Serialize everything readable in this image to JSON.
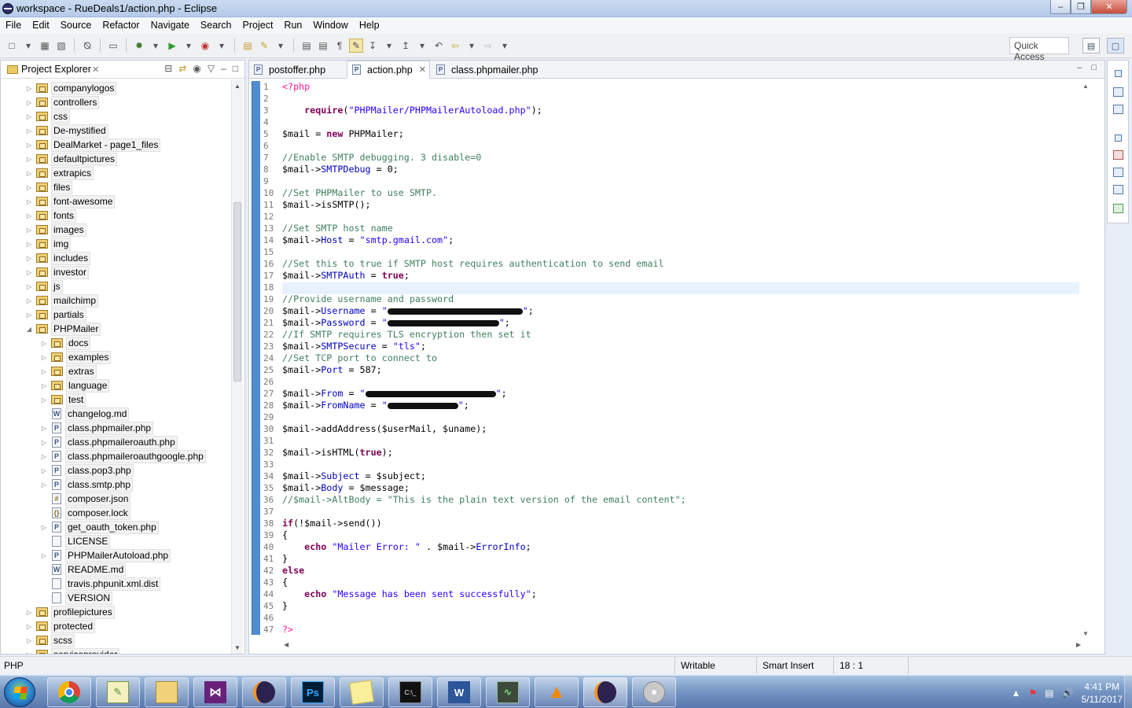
{
  "window": {
    "title": "workspace - RueDeals1/action.php - Eclipse"
  },
  "menu": [
    "File",
    "Edit",
    "Source",
    "Refactor",
    "Navigate",
    "Search",
    "Project",
    "Run",
    "Window",
    "Help"
  ],
  "toolbar": {
    "quick_access": "Quick Access"
  },
  "explorer": {
    "title": "Project Explorer",
    "items": [
      {
        "label": "companylogos",
        "depth": 0,
        "type": "folder",
        "twist": "closed"
      },
      {
        "label": "controllers",
        "depth": 0,
        "type": "folder",
        "twist": "closed"
      },
      {
        "label": "css",
        "depth": 0,
        "type": "folder",
        "twist": "closed"
      },
      {
        "label": "De-mystified",
        "depth": 0,
        "type": "folder",
        "twist": "closed"
      },
      {
        "label": "DealMarket - page1_files",
        "depth": 0,
        "type": "folder",
        "twist": "closed"
      },
      {
        "label": "defaultpictures",
        "depth": 0,
        "type": "folder",
        "twist": "closed"
      },
      {
        "label": "extrapics",
        "depth": 0,
        "type": "folder",
        "twist": "closed"
      },
      {
        "label": "files",
        "depth": 0,
        "type": "folder",
        "twist": "closed"
      },
      {
        "label": "font-awesome",
        "depth": 0,
        "type": "folder",
        "twist": "closed"
      },
      {
        "label": "fonts",
        "depth": 0,
        "type": "folder",
        "twist": "closed"
      },
      {
        "label": "images",
        "depth": 0,
        "type": "folder",
        "twist": "closed"
      },
      {
        "label": "img",
        "depth": 0,
        "type": "folder",
        "twist": "closed"
      },
      {
        "label": "includes",
        "depth": 0,
        "type": "folder",
        "twist": "closed"
      },
      {
        "label": "investor",
        "depth": 0,
        "type": "folder",
        "twist": "closed"
      },
      {
        "label": "js",
        "depth": 0,
        "type": "folder",
        "twist": "closed"
      },
      {
        "label": "mailchimp",
        "depth": 0,
        "type": "folder",
        "twist": "closed"
      },
      {
        "label": "partials",
        "depth": 0,
        "type": "folder",
        "twist": "closed"
      },
      {
        "label": "PHPMailer",
        "depth": 0,
        "type": "folder",
        "twist": "open"
      },
      {
        "label": "docs",
        "depth": 1,
        "type": "folder",
        "twist": "closed"
      },
      {
        "label": "examples",
        "depth": 1,
        "type": "folder",
        "twist": "closed"
      },
      {
        "label": "extras",
        "depth": 1,
        "type": "folder",
        "twist": "closed"
      },
      {
        "label": "language",
        "depth": 1,
        "type": "folder",
        "twist": "closed"
      },
      {
        "label": "test",
        "depth": 1,
        "type": "folder",
        "twist": "closed"
      },
      {
        "label": "changelog.md",
        "depth": 1,
        "type": "md",
        "twist": "none"
      },
      {
        "label": "class.phpmailer.php",
        "depth": 1,
        "type": "php",
        "twist": "closed"
      },
      {
        "label": "class.phpmaileroauth.php",
        "depth": 1,
        "type": "php",
        "twist": "closed"
      },
      {
        "label": "class.phpmaileroauthgoogle.php",
        "depth": 1,
        "type": "php",
        "twist": "closed"
      },
      {
        "label": "class.pop3.php",
        "depth": 1,
        "type": "php",
        "twist": "closed"
      },
      {
        "label": "class.smtp.php",
        "depth": 1,
        "type": "php",
        "twist": "closed"
      },
      {
        "label": "composer.json",
        "depth": 1,
        "type": "json",
        "twist": "none"
      },
      {
        "label": "composer.lock",
        "depth": 1,
        "type": "lock",
        "twist": "none"
      },
      {
        "label": "get_oauth_token.php",
        "depth": 1,
        "type": "php",
        "twist": "closed"
      },
      {
        "label": "LICENSE",
        "depth": 1,
        "type": "file",
        "twist": "none"
      },
      {
        "label": "PHPMailerAutoload.php",
        "depth": 1,
        "type": "php",
        "twist": "closed"
      },
      {
        "label": "README.md",
        "depth": 1,
        "type": "md",
        "twist": "none"
      },
      {
        "label": "travis.phpunit.xml.dist",
        "depth": 1,
        "type": "file",
        "twist": "none"
      },
      {
        "label": "VERSION",
        "depth": 1,
        "type": "file",
        "twist": "none"
      },
      {
        "label": "profilepictures",
        "depth": 0,
        "type": "folder",
        "twist": "closed"
      },
      {
        "label": "protected",
        "depth": 0,
        "type": "folder",
        "twist": "closed"
      },
      {
        "label": "scss",
        "depth": 0,
        "type": "folder",
        "twist": "closed"
      },
      {
        "label": "serviceprovider",
        "depth": 0,
        "type": "folder",
        "twist": "closed"
      }
    ]
  },
  "editor": {
    "tabs": [
      {
        "label": "postoffer.php",
        "active": false
      },
      {
        "label": "action.php",
        "active": true
      },
      {
        "label": "class.phpmailer.php",
        "active": false
      }
    ],
    "lines": [
      "<?php",
      "",
      "    require(\"PHPMailer/PHPMailerAutoload.php\");",
      "",
      "$mail = new PHPMailer;",
      "",
      "//Enable SMTP debugging. 3 disable=0",
      "$mail->SMTPDebug = 0;",
      "",
      "//Set PHPMailer to use SMTP.",
      "$mail->isSMTP();",
      "",
      "//Set SMTP host name",
      "$mail->Host = \"smtp.gmail.com\";",
      "",
      "//Set this to true if SMTP host requires authentication to send email",
      "$mail->SMTPAuth = true;",
      "",
      "//Provide username and password",
      "$mail->Username = \"█\";",
      "$mail->Password = \"█\";",
      "//If SMTP requires TLS encryption then set it",
      "$mail->SMTPSecure = \"tls\";",
      "//Set TCP port to connect to",
      "$mail->Port = 587;",
      "",
      "$mail->From = \"█\";",
      "$mail->FromName = \"█\";",
      "",
      "$mail->addAddress($userMail, $uname);",
      "",
      "$mail->isHTML(true);",
      "",
      "$mail->Subject = $subject;",
      "$mail->Body = $message;",
      "//$mail->AltBody = \"This is the plain text version of the email content\";",
      "",
      "if(!$mail->send())",
      "{",
      "    echo \"Mailer Error: \" . $mail->ErrorInfo;",
      "}",
      "else",
      "{",
      "    echo \"Message has been sent successfully\";",
      "}",
      "",
      "?>"
    ]
  },
  "status": {
    "language": "PHP",
    "writable": "Writable",
    "insert_mode": "Smart Insert",
    "cursor": "18 : 1"
  },
  "taskbar": {
    "time": "4:41 PM",
    "date": "5/11/2017"
  },
  "colors": {
    "keyword": "#7f0055",
    "string": "#2a00ff",
    "comment": "#3f7f5f",
    "property": "#0000c0",
    "php_tag": "#ff1493",
    "gutter_bar": "#4f8dd0"
  }
}
